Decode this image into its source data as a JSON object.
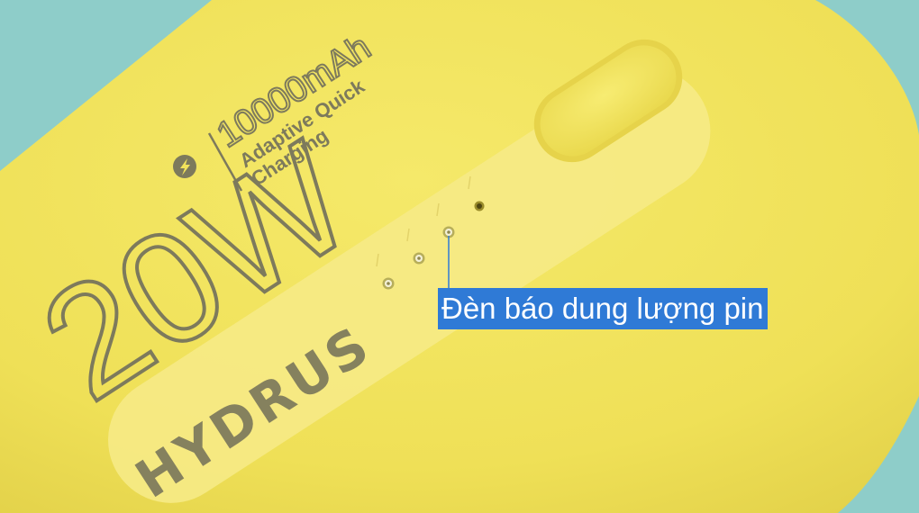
{
  "image": {
    "subject": "yellow power bank close-up",
    "colors": {
      "background": "#8ecdc9",
      "body": "#f1e35a",
      "strip": "#f6ea86",
      "printed_text": "#7d7a5c",
      "callout_bg": "#2f7ad6",
      "callout_text": "#ffffff",
      "leader_line": "#2f7ad6"
    }
  },
  "product_print": {
    "power": "20W",
    "capacity": "10000mAh",
    "feature_line1": "Adaptive Quick",
    "feature_line2": "Charging",
    "brand": "HYDRUS"
  },
  "callout": {
    "label": "Đèn báo dung lượng pin"
  }
}
